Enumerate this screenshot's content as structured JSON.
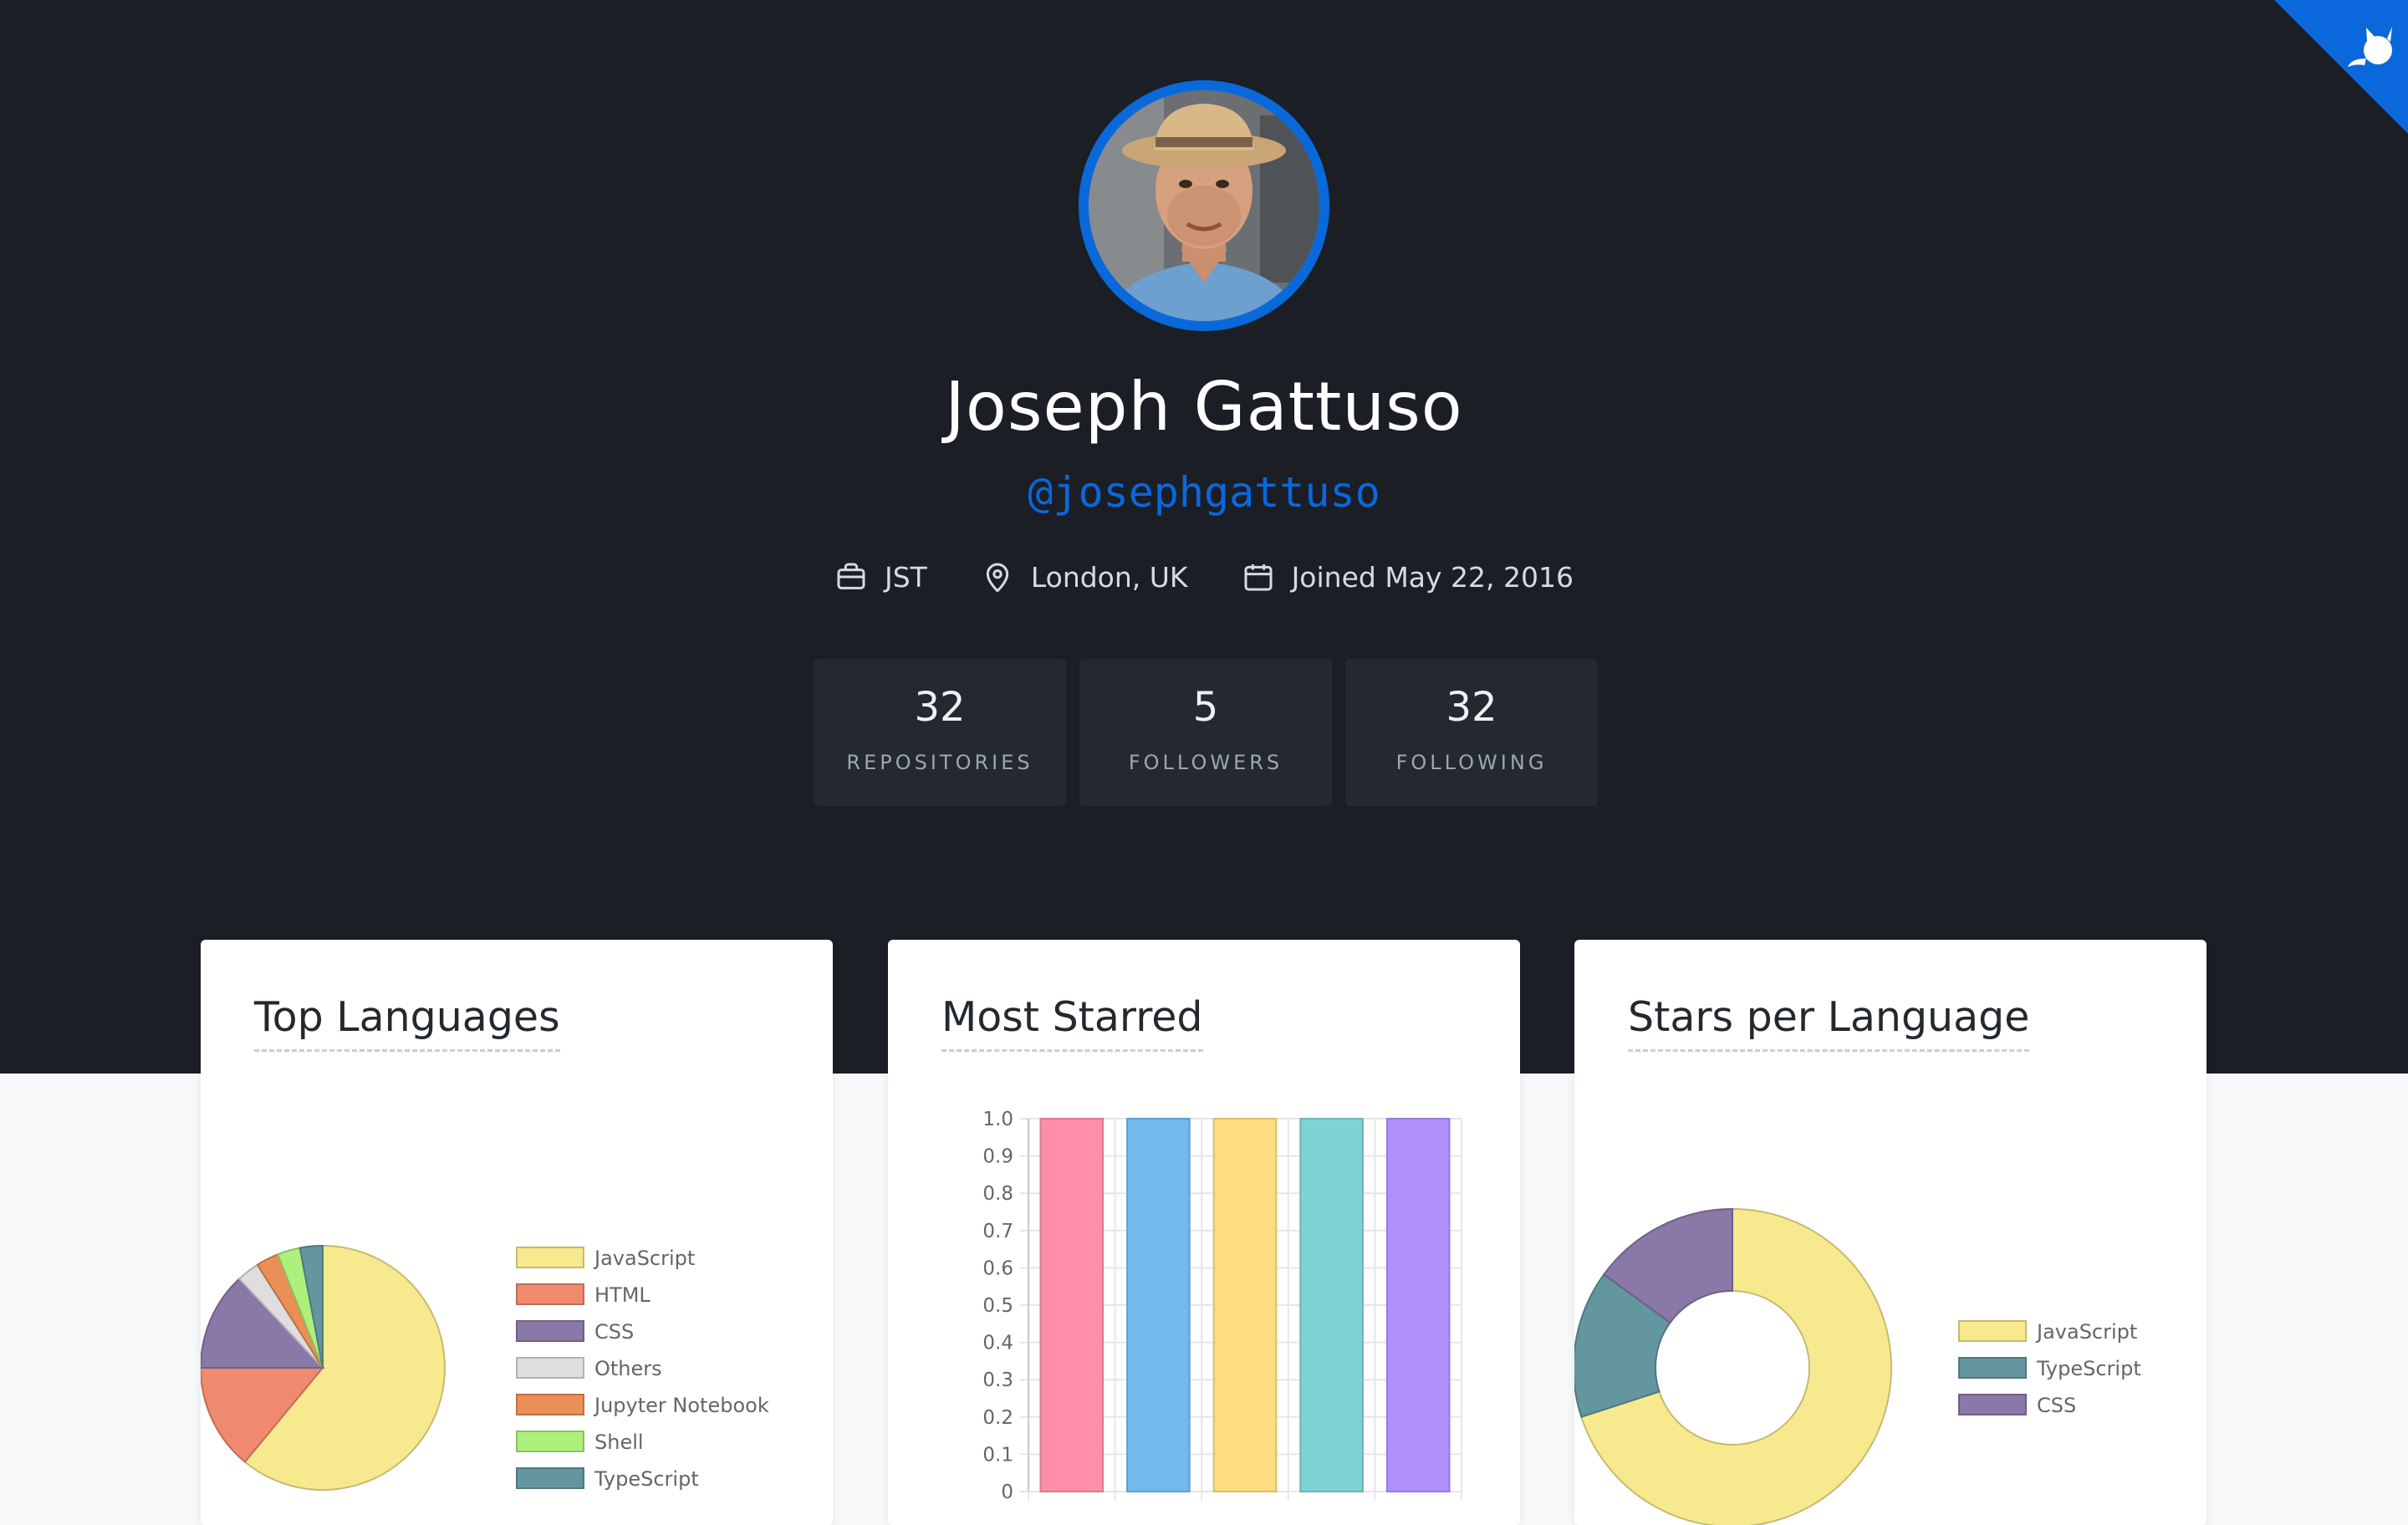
{
  "profile": {
    "name": "Joseph Gattuso",
    "handle": "@josephgattuso",
    "company": "JST",
    "location": "London, UK",
    "joined": "Joined May 22, 2016",
    "icons": {
      "company": "briefcase-icon",
      "location": "map-pin-icon",
      "joined": "calendar-icon",
      "corner": "github-octocat-icon"
    }
  },
  "stats": [
    {
      "value": "32",
      "label": "REPOSITORIES"
    },
    {
      "value": "5",
      "label": "FOLLOWERS"
    },
    {
      "value": "32",
      "label": "FOLLOWING"
    }
  ],
  "colors": {
    "accent": "#0969da",
    "hero_bg": "#1b1e25",
    "stat_bg": "#24282f"
  },
  "cards": {
    "top_languages": "Top Languages",
    "most_starred": "Most Starred",
    "stars_per_language": "Stars per Language"
  },
  "chart_data": [
    {
      "type": "pie",
      "labels": [
        "JavaScript",
        "HTML",
        "CSS",
        "Others",
        "Jupyter Notebook",
        "Shell",
        "TypeScript"
      ],
      "values": [
        61,
        14,
        13,
        3,
        3,
        3,
        3
      ],
      "colors": [
        "#f7e98e",
        "#ef8a6f",
        "#8a78a8",
        "#dedede",
        "#ea8f56",
        "#aef07c",
        "#64969f"
      ],
      "legend": "right"
    },
    {
      "type": "bar",
      "categories": [
        "",
        "",
        "",
        "",
        ""
      ],
      "values": [
        1,
        1,
        1,
        1,
        1
      ],
      "colors": [
        "#ff8fa8",
        "#72baee",
        "#ffdd80",
        "#7fd3d3",
        "#b290fb"
      ],
      "ylim": [
        0,
        1
      ],
      "yticks": [
        "0",
        "0.1",
        "0.2",
        "0.3",
        "0.4",
        "0.5",
        "0.6",
        "0.7",
        "0.8",
        "0.9",
        "1.0"
      ],
      "grid": true
    },
    {
      "type": "pie",
      "donut": true,
      "labels": [
        "JavaScript",
        "TypeScript",
        "CSS"
      ],
      "values": [
        70,
        15,
        15
      ],
      "colors": [
        "#f7e98e",
        "#64969f",
        "#8a78a8"
      ],
      "legend": "right"
    }
  ]
}
